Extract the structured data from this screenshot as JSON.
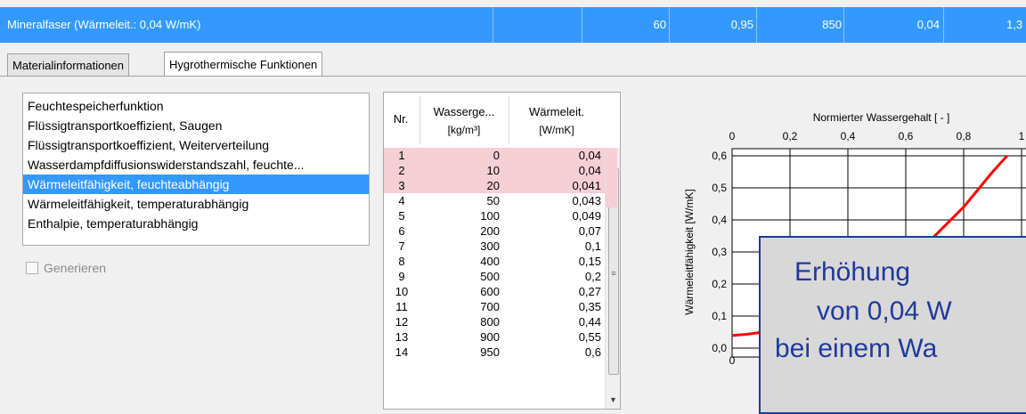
{
  "material_row": {
    "name": "Mineralfaser (Wärmeleit.: 0,04 W/mK)",
    "values": [
      "60",
      "0,95",
      "850",
      "0,04",
      "1,3"
    ]
  },
  "tabs": [
    {
      "label": "Materialinformationen",
      "active": false
    },
    {
      "label": "Hygrothermische Funktionen",
      "active": true
    }
  ],
  "functions": {
    "items": [
      "Feuchtespeicherfunktion",
      "Flüssigtransportkoeffizient, Saugen",
      "Flüssigtransportkoeffizient, Weiterverteilung",
      "Wasserdampfdiffusionswiderstandszahl, feuchte...",
      "Wärmeleitfähigkeit, feuchteabhängig",
      "Wärmeleitfähigkeit, temperaturabhängig",
      "Enthalpie, temperaturabhängig"
    ],
    "selected_index": 4
  },
  "generate_label": "Generieren",
  "table": {
    "headers": {
      "nr": "Nr.",
      "col1_line1": "Wasserge...",
      "col1_line2": "[kg/m³]",
      "col2_line1": "Wärmeleit.",
      "col2_line2": "[W/mK]"
    },
    "rows": [
      {
        "nr": "1",
        "w": "0",
        "l": "0,04"
      },
      {
        "nr": "2",
        "w": "10",
        "l": "0,04"
      },
      {
        "nr": "3",
        "w": "20",
        "l": "0,041"
      },
      {
        "nr": "4",
        "w": "50",
        "l": "0,043"
      },
      {
        "nr": "5",
        "w": "100",
        "l": "0,049"
      },
      {
        "nr": "6",
        "w": "200",
        "l": "0,07"
      },
      {
        "nr": "7",
        "w": "300",
        "l": "0,1"
      },
      {
        "nr": "8",
        "w": "400",
        "l": "0,15"
      },
      {
        "nr": "9",
        "w": "500",
        "l": "0,2"
      },
      {
        "nr": "10",
        "w": "600",
        "l": "0,27"
      },
      {
        "nr": "11",
        "w": "700",
        "l": "0,35"
      },
      {
        "nr": "12",
        "w": "800",
        "l": "0,44"
      },
      {
        "nr": "13",
        "w": "900",
        "l": "0,55"
      },
      {
        "nr": "14",
        "w": "950",
        "l": "0,6"
      }
    ],
    "highlighted_rows": [
      0,
      1,
      2
    ],
    "highlight_color": "#f6cfd6"
  },
  "chart_data": {
    "type": "line",
    "title": "Normierter Wassergehalt [ - ]",
    "xlabel": "",
    "ylabel": "Wärmeleitfähigkeit [W/mK]",
    "x_ticks": [
      "0",
      "0,2",
      "0,4",
      "0,6",
      "0,8",
      "1"
    ],
    "x_range": [
      0,
      1
    ],
    "bottom_tick": "0",
    "y_ticks": [
      "0,0",
      "0,1",
      "0,2",
      "0,3",
      "0,4",
      "0,5",
      "0,6"
    ],
    "y_range": [
      0,
      0.6
    ],
    "grid": true,
    "series": [
      {
        "color": "#ff0000",
        "x": [
          0,
          0.01,
          0.02,
          0.05,
          0.1,
          0.2,
          0.3,
          0.4,
          0.5,
          0.6,
          0.7,
          0.8,
          0.9,
          0.95
        ],
        "y": [
          0.04,
          0.04,
          0.041,
          0.043,
          0.049,
          0.07,
          0.1,
          0.15,
          0.2,
          0.27,
          0.35,
          0.44,
          0.55,
          0.6
        ]
      }
    ]
  },
  "callout": {
    "line1": "Erhöhung",
    "line2": "von 0,04 W",
    "line3": "bei einem Wa",
    "border_color": "#1f3a9e"
  }
}
